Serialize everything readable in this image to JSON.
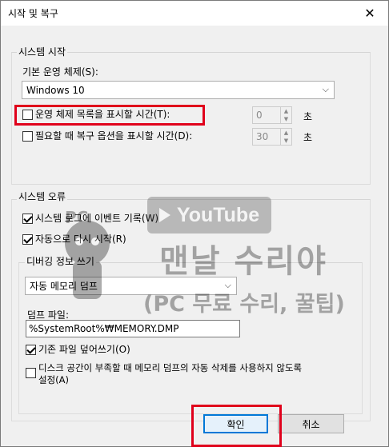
{
  "window": {
    "title": "시작 및 복구"
  },
  "system_startup": {
    "group_label": "시스템 시작",
    "default_os_label": "기본 운영 체제(S):",
    "default_os_value": "Windows 10",
    "show_os_list_label": "운영 체제 목록을 표시할 시간(T):",
    "show_os_list_checked": false,
    "show_os_list_value": "0",
    "show_os_list_unit": "초",
    "show_recovery_label": "필요할 때 복구 옵션을 표시할 시간(D):",
    "show_recovery_checked": false,
    "show_recovery_value": "30",
    "show_recovery_unit": "초"
  },
  "system_failure": {
    "group_label": "시스템 오류",
    "write_event_label": "시스템 로그에 이벤트 기록(W)",
    "write_event_checked": true,
    "auto_restart_label": "자동으로 다시 시작(R)",
    "auto_restart_checked": true,
    "debug_info_label": "디버깅 정보 쓰기",
    "debug_info_value": "자동 메모리 덤프",
    "dump_file_label": "덤프 파일:",
    "dump_file_value": "%SystemRoot%₩MEMORY.DMP",
    "overwrite_label": "기존 파일 덮어쓰기(O)",
    "overwrite_checked": true,
    "disable_autodelete_label_line1": "디스크 공간이 부족할 때 메모리 덤프의 자동 삭제를 사용하지 않도록",
    "disable_autodelete_label_line2": "설정(A)",
    "disable_autodelete_checked": false
  },
  "buttons": {
    "ok": "확인",
    "cancel": "취소"
  },
  "watermark": {
    "youtube": "YouTube",
    "channel": "맨날 수리야",
    "subtitle": "(PC 무료 수리, 꿀팁)",
    "pc": "PC"
  },
  "colors": {
    "highlight": "#e0001b",
    "accent": "#0078d7"
  },
  "icons": {
    "close": "close-icon",
    "dropdown": "chevron-down-icon",
    "spin": "spin-arrows-icon"
  }
}
